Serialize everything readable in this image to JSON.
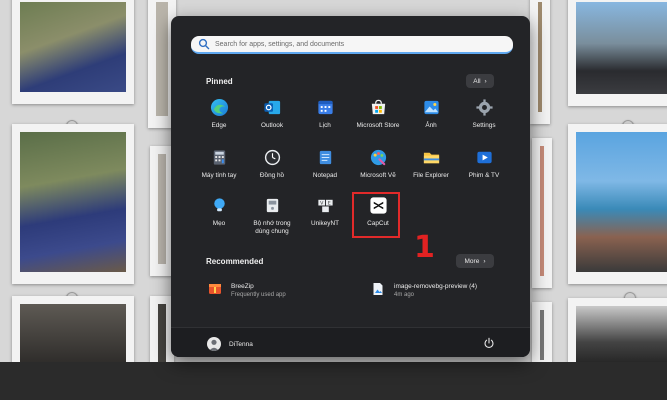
{
  "search": {
    "placeholder": "Search for apps, settings, and documents"
  },
  "pinned": {
    "title": "Pinned",
    "all_button": "All",
    "apps": [
      {
        "label": "Edge",
        "icon": "edge-icon"
      },
      {
        "label": "Outlook",
        "icon": "outlook-icon"
      },
      {
        "label": "Lịch",
        "icon": "calendar-icon"
      },
      {
        "label": "Microsoft Store",
        "icon": "store-icon"
      },
      {
        "label": "Ảnh",
        "icon": "photos-icon"
      },
      {
        "label": "Settings",
        "icon": "gear-icon"
      },
      {
        "label": "Máy tính tay",
        "icon": "calculator-icon"
      },
      {
        "label": "Đồng hồ",
        "icon": "clock-icon"
      },
      {
        "label": "Notepad",
        "icon": "notepad-icon"
      },
      {
        "label": "Microsoft Vẽ",
        "icon": "paint-icon"
      },
      {
        "label": "File Explorer",
        "icon": "folder-icon"
      },
      {
        "label": "Phim & TV",
        "icon": "movies-icon"
      },
      {
        "label": "Mẹo",
        "icon": "tips-icon"
      },
      {
        "label": "Bộ nhớ trong dùng chung",
        "icon": "shared-storage-icon"
      },
      {
        "label": "UnikeyNT",
        "icon": "unikey-icon"
      },
      {
        "label": "CapCut",
        "icon": "capcut-icon"
      }
    ]
  },
  "annotation": {
    "number": "1",
    "color": "#e22222"
  },
  "recommended": {
    "title": "Recommended",
    "more_button": "More",
    "items": [
      {
        "name": "BreeZip",
        "sub": "Frequently used app",
        "icon": "breezip-icon"
      },
      {
        "name": "image-removebg-preview (4)",
        "sub": "4m ago",
        "icon": "image-file-icon"
      }
    ]
  },
  "user": {
    "name": "DiTenna"
  },
  "colors": {
    "panel": "#232427",
    "accent": "#5fa8f0",
    "highlight": "#e12a2a"
  }
}
